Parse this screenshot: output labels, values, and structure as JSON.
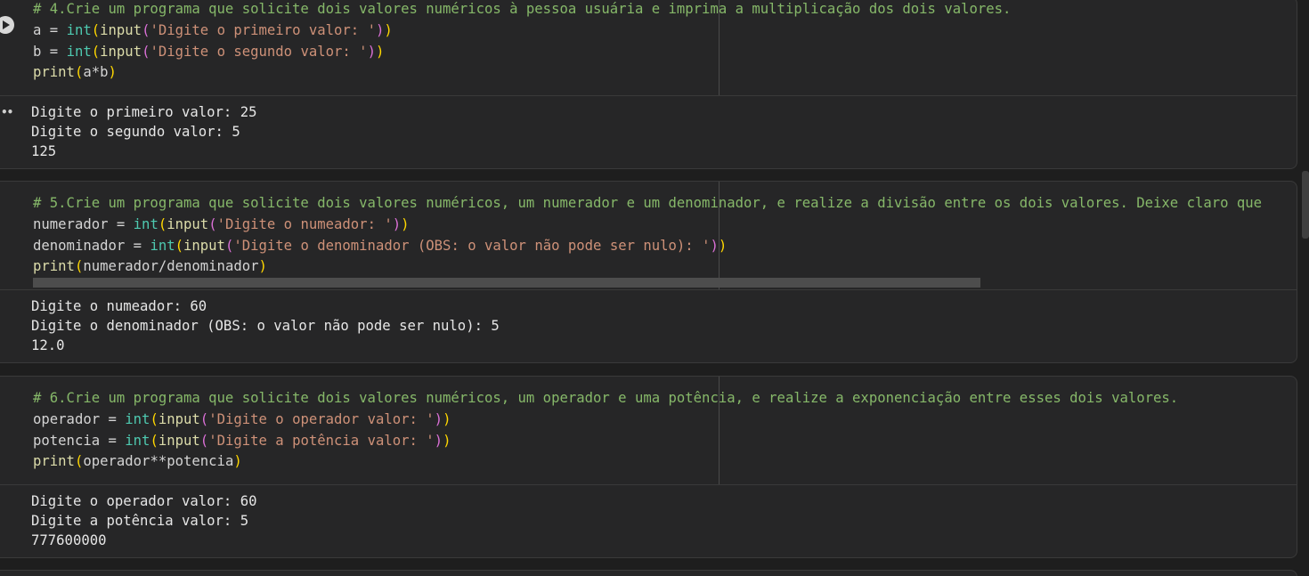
{
  "cells": [
    {
      "code": {
        "comment": "# 4.Crie um programa que solicite dois valores numéricos à pessoa usuária e imprima a multiplicação dos dois valores.",
        "line1": {
          "var": "a = ",
          "kw": "int",
          "p1": "(",
          "fn": "input",
          "p2": "(",
          "str": "'Digite o primeiro valor: '",
          "c2": ")",
          "c1": ")"
        },
        "line2": {
          "var": "b = ",
          "kw": "int",
          "p1": "(",
          "fn": "input",
          "p2": "(",
          "str": "'Digite o segundo valor: '",
          "c2": ")",
          "c1": ")"
        },
        "line3": {
          "fn": "print",
          "p1": "(",
          "arg": "a*b",
          "c1": ")"
        }
      },
      "output": [
        "Digite o primeiro valor: 25",
        "Digite o segundo valor: 5",
        "125"
      ]
    },
    {
      "code": {
        "comment": "# 5.Crie um programa que solicite dois valores numéricos, um numerador e um denominador, e realize a divisão entre os dois valores. Deixe claro que",
        "line1": {
          "var": "numerador = ",
          "kw": "int",
          "p1": "(",
          "fn": "input",
          "p2": "(",
          "str": "'Digite o numeador: '",
          "c2": ")",
          "c1": ")"
        },
        "line2": {
          "var": "denominador = ",
          "kw": "int",
          "p1": "(",
          "fn": "input",
          "p2": "(",
          "str": "'Digite o denominador (OBS: o valor não pode ser nulo): '",
          "c2": ")",
          "c1": ")"
        },
        "line3": {
          "fn": "print",
          "p1": "(",
          "arg": "numerador/denominador",
          "c1": ")"
        }
      },
      "output": [
        "Digite o numeador: 60",
        "Digite o denominador (OBS: o valor não pode ser nulo): 5",
        "12.0"
      ]
    },
    {
      "code": {
        "comment": "# 6.Crie um programa que solicite dois valores numéricos, um operador e uma potência, e realize a exponenciação entre esses dois valores.",
        "line1": {
          "var": "operador = ",
          "kw": "int",
          "p1": "(",
          "fn": "input",
          "p2": "(",
          "str": "'Digite o operador valor: '",
          "c2": ")",
          "c1": ")"
        },
        "line2": {
          "var": "potencia = ",
          "kw": "int",
          "p1": "(",
          "fn": "input",
          "p2": "(",
          "str": "'Digite a potência valor: '",
          "c2": ")",
          "c1": ")"
        },
        "line3": {
          "fn": "print",
          "p1": "(",
          "arg": "operador**potencia",
          "c1": ")"
        }
      },
      "output": [
        "Digite o operador valor: 60",
        "Digite a potência valor: 5",
        "777600000"
      ]
    }
  ],
  "icons": {
    "run": "play-circle-icon",
    "output_menu": "more-horizontal-icon"
  },
  "colors": {
    "background": "#1e1e1e",
    "cell": "#262627",
    "comment": "#86b869",
    "builtin": "#4ec9b0",
    "function": "#dcdcaa",
    "string": "#ce9178",
    "bracket1": "#ffd700",
    "bracket2": "#da70d6"
  }
}
